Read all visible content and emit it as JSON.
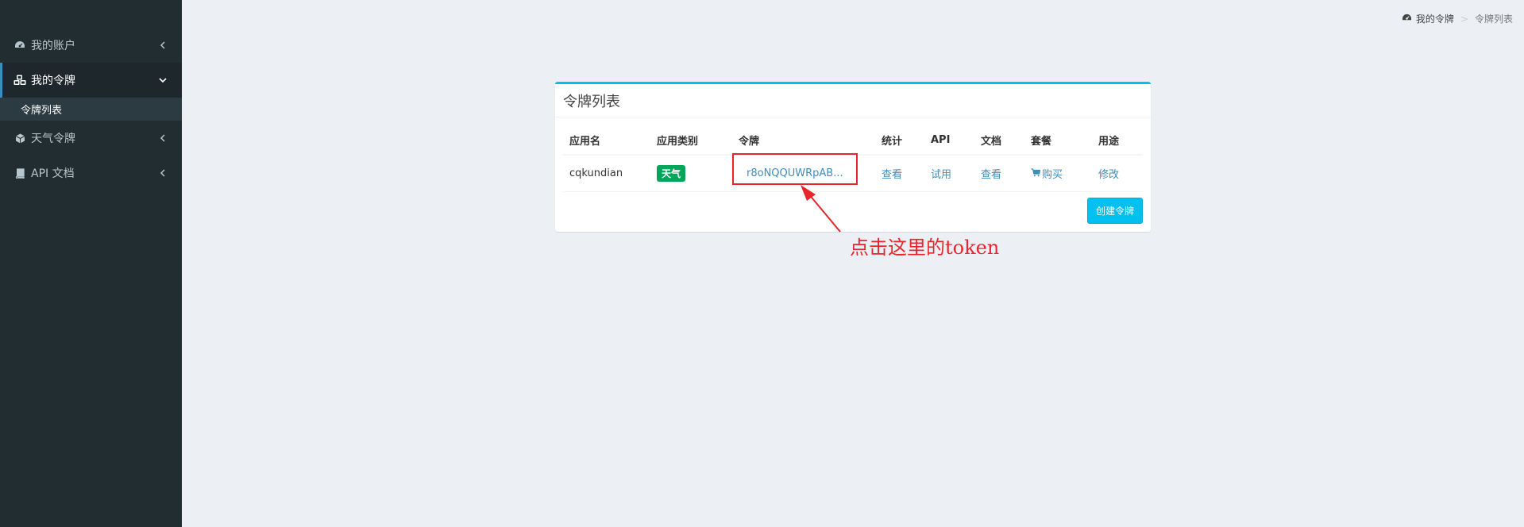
{
  "sidebar": {
    "items": [
      {
        "label": "我的账户",
        "icon": "dashboard-icon"
      },
      {
        "label": "我的令牌",
        "icon": "cubes-icon",
        "active": true,
        "submenu": [
          {
            "label": "令牌列表"
          }
        ]
      },
      {
        "label": "天气令牌",
        "icon": "cube-icon"
      },
      {
        "label": "API 文档",
        "icon": "book-icon"
      }
    ]
  },
  "breadcrumb": {
    "parent": "我的令牌",
    "separator": ">",
    "current": "令牌列表"
  },
  "box": {
    "title": "令牌列表",
    "columns": [
      "应用名",
      "应用类别",
      "令牌",
      "统计",
      "API",
      "文档",
      "套餐",
      "用途"
    ],
    "rows": [
      {
        "app_name": "cqkundian",
        "category": "天气",
        "token": "r8oNQQUWRpAB...",
        "stats": "查看",
        "api": "试用",
        "docs": "查看",
        "plan": "购买",
        "usage": "修改"
      }
    ],
    "create_button": "创建令牌"
  },
  "annotation": {
    "text": "点击这里的token"
  },
  "colors": {
    "sidebar_bg": "#222d32",
    "page_bg": "#ecf0f5",
    "accent": "#00c0ef",
    "link": "#3c8dbc",
    "label_green": "#00a65a",
    "annotation_red": "#e8252b"
  }
}
